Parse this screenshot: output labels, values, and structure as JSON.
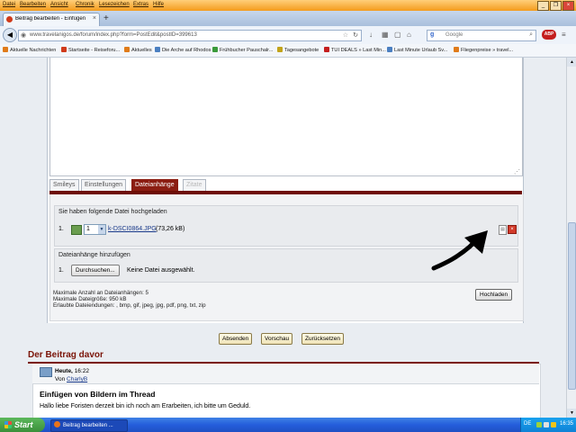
{
  "menu": [
    "Datei",
    "Bearbeiten",
    "Ansicht",
    "Chronik",
    "Lesezeichen",
    "Extras",
    "Hilfe"
  ],
  "tab": {
    "title": "Beitrag bearbeiten - Einfügen ...",
    "close": "×",
    "new": "+"
  },
  "address": {
    "url": "www.travelanigos.de/forum/index.php?form=PostEdit&postID=399613"
  },
  "search": {
    "engine": "g",
    "placeholder": "Google"
  },
  "bookmarks": [
    "Aktuelle Nachrichten",
    "Startseite - Reiseforu...",
    "Aktuelles",
    "Die Arche auf Rhodos",
    "Frühbucher Pauschalr...",
    "Tagesangebote",
    "TUI DEALS » Last Min...",
    "Last Minute Urlaub Sv...",
    "Fliegenpreise » travel..."
  ],
  "editor_tabs": [
    {
      "label": "Smileys",
      "state": "normal"
    },
    {
      "label": "Einstellungen",
      "state": "normal"
    },
    {
      "label": "Dateianhänge",
      "state": "active"
    },
    {
      "label": "Zitate",
      "state": "disabled"
    }
  ],
  "uploaded": {
    "legend": "Sie haben folgende Datei hochgeladen",
    "num": "1.",
    "select_value": "1",
    "filename": "k-DSCI0864.JPG",
    "filesize": "(73,26 kB)"
  },
  "add": {
    "legend": "Dateianhänge hinzufügen",
    "num": "1.",
    "browse": "Durchsuchen...",
    "nofile": "Keine Datei ausgewählt."
  },
  "limits": {
    "max_count": "Maximale Anzahl an Dateianhängen: 5",
    "max_size": "Maximale Dateigröße: 950 kB",
    "extensions": "Erlaubte Dateiendungen: , bmp, gif, jpeg, jpg, pdf, png, txt, zip"
  },
  "upload_button": "Hochladen",
  "actions": {
    "submit": "Absenden",
    "preview": "Vorschau",
    "reset": "Zurücksetzen"
  },
  "previous": {
    "heading": "Der Beitrag davor",
    "date_label": "Heute,",
    "time": "16:22",
    "by": "Von",
    "author": "CharlyB",
    "title": "Einfügen von Bildern im Thread",
    "text": "Hallo liebe Foristen derzeit bin ich noch am Erarbeiten, ich bitte um Geduld."
  },
  "taskbar": {
    "start": "Start",
    "item": "Beitrag bearbeiten ...",
    "lang": "DE",
    "clock": "16:35"
  },
  "colors": {
    "accent": "#8b1d12",
    "heading": "#7a1307"
  }
}
